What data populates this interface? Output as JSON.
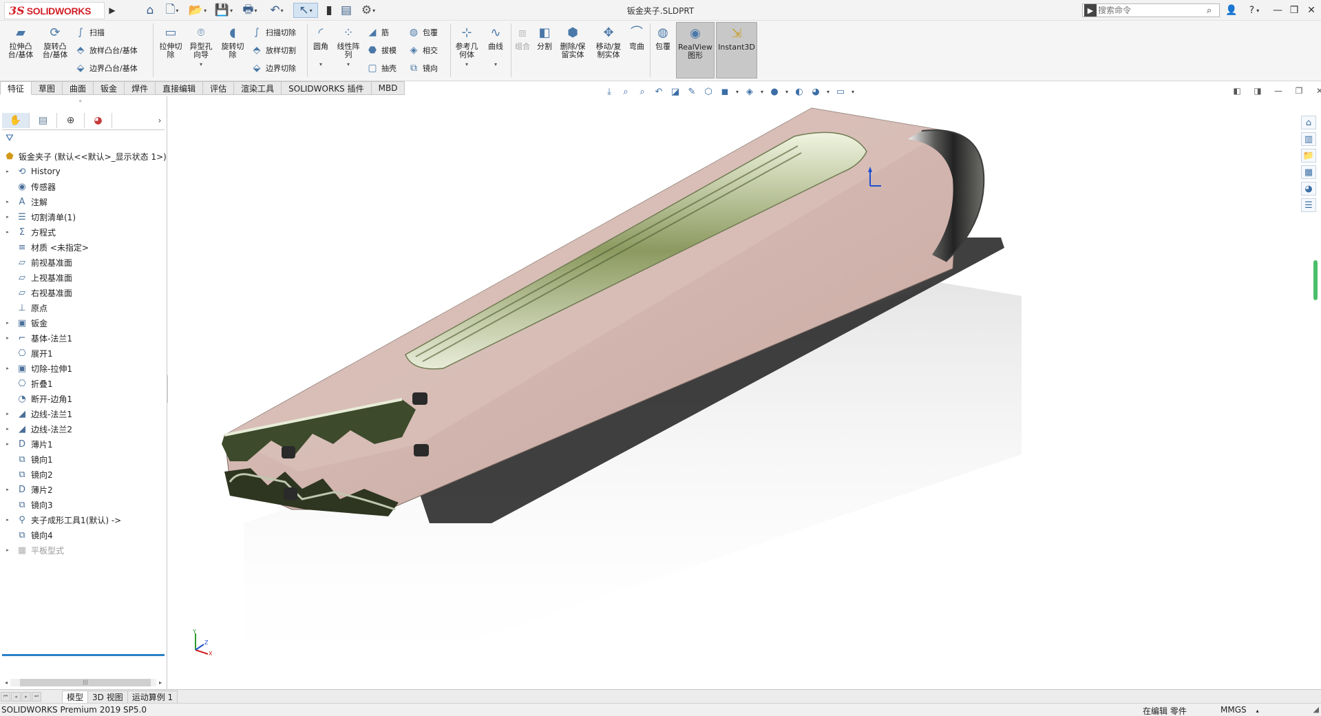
{
  "app": {
    "logo_ds": "3S",
    "logo_text": "SOLIDWORKS",
    "document_title": "钣金夹子.SLDPRT",
    "search_placeholder": "搜索命令",
    "brand_color": "#d22027"
  },
  "quick_access": [
    {
      "name": "home-icon",
      "glyph": "⌂"
    },
    {
      "name": "new-document-icon",
      "glyph": "🗋"
    },
    {
      "name": "open-icon",
      "glyph": "📂"
    },
    {
      "name": "save-icon",
      "glyph": "💾"
    },
    {
      "name": "print-icon",
      "glyph": "🖶"
    },
    {
      "name": "undo-icon",
      "glyph": "↶"
    },
    {
      "name": "select-icon",
      "glyph": "↖"
    },
    {
      "name": "rebuild-icon",
      "glyph": "▮"
    },
    {
      "name": "file-properties-icon",
      "glyph": "▤"
    },
    {
      "name": "options-icon",
      "glyph": "⚙"
    }
  ],
  "commands": {
    "extrude_boss": "拉伸凸\n台/基体",
    "revolve_boss": "旋转凸\n台/基体",
    "sweep": "扫描",
    "loft_boss": "放样凸台/基体",
    "boundary_boss": "边界凸台/基体",
    "extrude_cut": "拉伸切\n除",
    "hole_wizard": "异型孔\n向导",
    "revolve_cut": "旋转切\n除",
    "swept_cut": "扫描切除",
    "lofted_cut": "放样切割",
    "boundary_cut": "边界切除",
    "fillet": "圆角",
    "linear_pattern": "线性阵\n列",
    "rib": "筋",
    "draft": "拔模",
    "shell": "抽壳",
    "wrap": "包覆",
    "intersect": "相交",
    "mirror": "镜向",
    "ref_geometry": "参考几\n何体",
    "curves": "曲线",
    "combine": "组合",
    "split": "分割",
    "delete_keep_body": "删除/保\n留实体",
    "move_copy_body": "移动/复\n制实体",
    "flex": "弯曲",
    "wrap2": "包覆",
    "realview": "RealView\n图形",
    "instant3d": "Instant3D"
  },
  "tabs": [
    "特征",
    "草图",
    "曲面",
    "钣金",
    "焊件",
    "直接编辑",
    "评估",
    "渲染工具",
    "SOLIDWORKS 插件",
    "MBD"
  ],
  "active_tab": "特征",
  "feature_tree": {
    "root": "钣金夹子 (默认<<默认>_显示状态 1>)",
    "items": [
      {
        "label": "History",
        "icon": "history-icon",
        "glyph": "⟲",
        "expand": true
      },
      {
        "label": "传感器",
        "icon": "sensor-icon",
        "glyph": "◉",
        "expand": false
      },
      {
        "label": "注解",
        "icon": "annotations-icon",
        "glyph": "A",
        "expand": true
      },
      {
        "label": "切割清单(1)",
        "icon": "cut-list-icon",
        "glyph": "☰",
        "expand": true
      },
      {
        "label": "方程式",
        "icon": "equations-icon",
        "glyph": "Σ",
        "expand": true
      },
      {
        "label": "材质 <未指定>",
        "icon": "material-icon",
        "glyph": "≡",
        "expand": false
      },
      {
        "label": "前视基准面",
        "icon": "plane-icon",
        "glyph": "▱",
        "expand": false
      },
      {
        "label": "上视基准面",
        "icon": "plane-icon",
        "glyph": "▱",
        "expand": false
      },
      {
        "label": "右视基准面",
        "icon": "plane-icon",
        "glyph": "▱",
        "expand": false
      },
      {
        "label": "原点",
        "icon": "origin-icon",
        "glyph": "⊥",
        "expand": false
      },
      {
        "label": "钣金",
        "icon": "sheet-metal-icon",
        "glyph": "▣",
        "expand": true
      },
      {
        "label": "基体-法兰1",
        "icon": "base-flange-icon",
        "glyph": "⌐",
        "expand": true
      },
      {
        "label": "展开1",
        "icon": "unfold-icon",
        "glyph": "⎔",
        "expand": false
      },
      {
        "label": "切除-拉伸1",
        "icon": "cut-extrude-icon",
        "glyph": "▣",
        "expand": true
      },
      {
        "label": "折叠1",
        "icon": "fold-icon",
        "glyph": "⎔",
        "expand": false
      },
      {
        "label": "断开-边角1",
        "icon": "break-corner-icon",
        "glyph": "◔",
        "expand": false
      },
      {
        "label": "边线-法兰1",
        "icon": "edge-flange-icon",
        "glyph": "◢",
        "expand": true
      },
      {
        "label": "边线-法兰2",
        "icon": "edge-flange-icon",
        "glyph": "◢",
        "expand": true
      },
      {
        "label": "薄片1",
        "icon": "tab-feature-icon",
        "glyph": "D",
        "expand": true
      },
      {
        "label": "镜向1",
        "icon": "mirror-icon",
        "glyph": "⧉",
        "expand": false
      },
      {
        "label": "镜向2",
        "icon": "mirror-icon",
        "glyph": "⧉",
        "expand": false
      },
      {
        "label": "薄片2",
        "icon": "tab-feature-icon",
        "glyph": "D",
        "expand": true
      },
      {
        "label": "镜向3",
        "icon": "mirror-icon",
        "glyph": "⧉",
        "expand": false
      },
      {
        "label": "夹子成形工具1(默认) ->",
        "icon": "forming-tool-icon",
        "glyph": "⚲",
        "expand": true
      },
      {
        "label": "镜向4",
        "icon": "mirror-icon",
        "glyph": "⧉",
        "expand": false
      },
      {
        "label": "平板型式",
        "icon": "flat-pattern-icon",
        "glyph": "▦",
        "expand": true,
        "suppressed": true
      }
    ]
  },
  "bottom_tabs": [
    "模型",
    "3D 视图",
    "运动算例 1"
  ],
  "status": {
    "product": "SOLIDWORKS Premium 2019 SP5.0",
    "editing": "在编辑 零件",
    "units": "MMGS"
  }
}
